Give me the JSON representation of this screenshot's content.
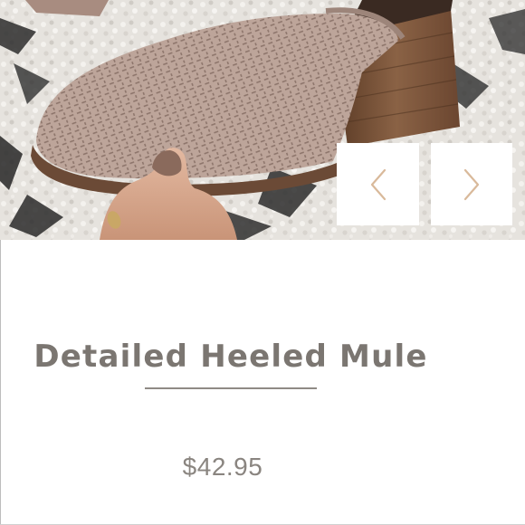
{
  "product": {
    "title": "Detailed Heeled Mule",
    "price": "$42.95"
  },
  "carousel": {
    "prev_icon": "chevron-left-icon",
    "next_icon": "chevron-right-icon"
  },
  "colors": {
    "title": "#7b7671",
    "price": "#8a8580",
    "divider": "#8f8a85",
    "chevron": "#d9b99a",
    "suede": "#b9a196",
    "heel": "#7a5438"
  }
}
